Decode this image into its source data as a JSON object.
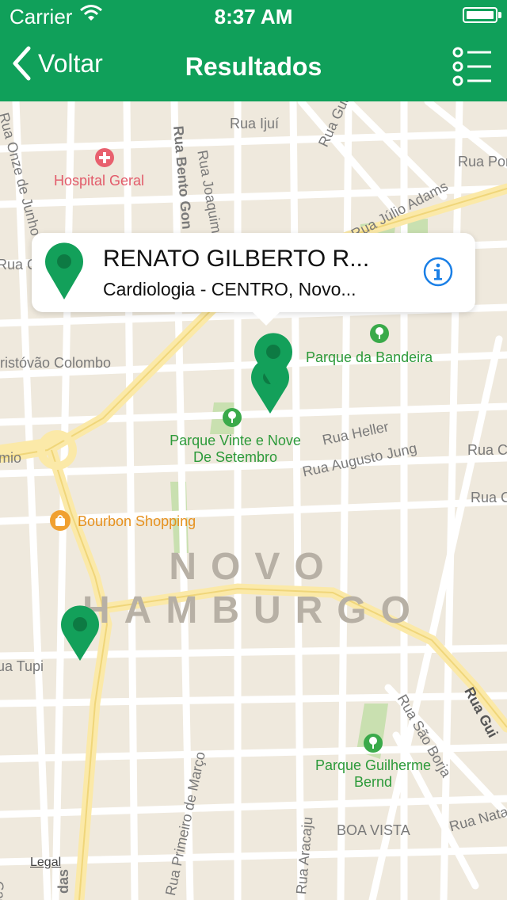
{
  "status_bar": {
    "carrier": "Carrier",
    "time": "8:37 AM"
  },
  "nav": {
    "back_label": "Voltar",
    "title": "Resultados"
  },
  "map": {
    "streets": [
      "Rua Ijuí",
      "Rua Guajuvira",
      "Rua Por",
      "Rua Onze de Junho",
      "Rua Bento Gon",
      "Rua Joaquim Ped",
      "Rua Júlio Adams",
      "Rua Q",
      "ristóvão Colombo",
      "Rua Heller",
      "Rua Augusto Jung",
      "Rua Co",
      "Rua Co",
      "mio",
      "ua Tupi",
      "Rua São Borja",
      "Rua Gui",
      "Rua Primeiro de Março",
      "Rua Aracaju",
      "Rua Natal",
      "Rua Caca",
      "das"
    ],
    "parks": [
      "Parque da Bandeira",
      "Parque Vinte e Nove De Setembro",
      "Parque Guilherme Bernd"
    ],
    "poi": "Bourbon Shopping",
    "hospital": "Hospital Geral",
    "city": "NOVO HAMBURGO",
    "district": "BOA VISTA",
    "partial_label": "Pe",
    "legal": "Legal"
  },
  "callout": {
    "name": "RENATO GILBERTO R...",
    "subtitle": "Cardiologia - CENTRO, Novo..."
  },
  "colors": {
    "brand": "#10a05a",
    "pin": "#13a05a",
    "info": "#1a7fe6"
  }
}
